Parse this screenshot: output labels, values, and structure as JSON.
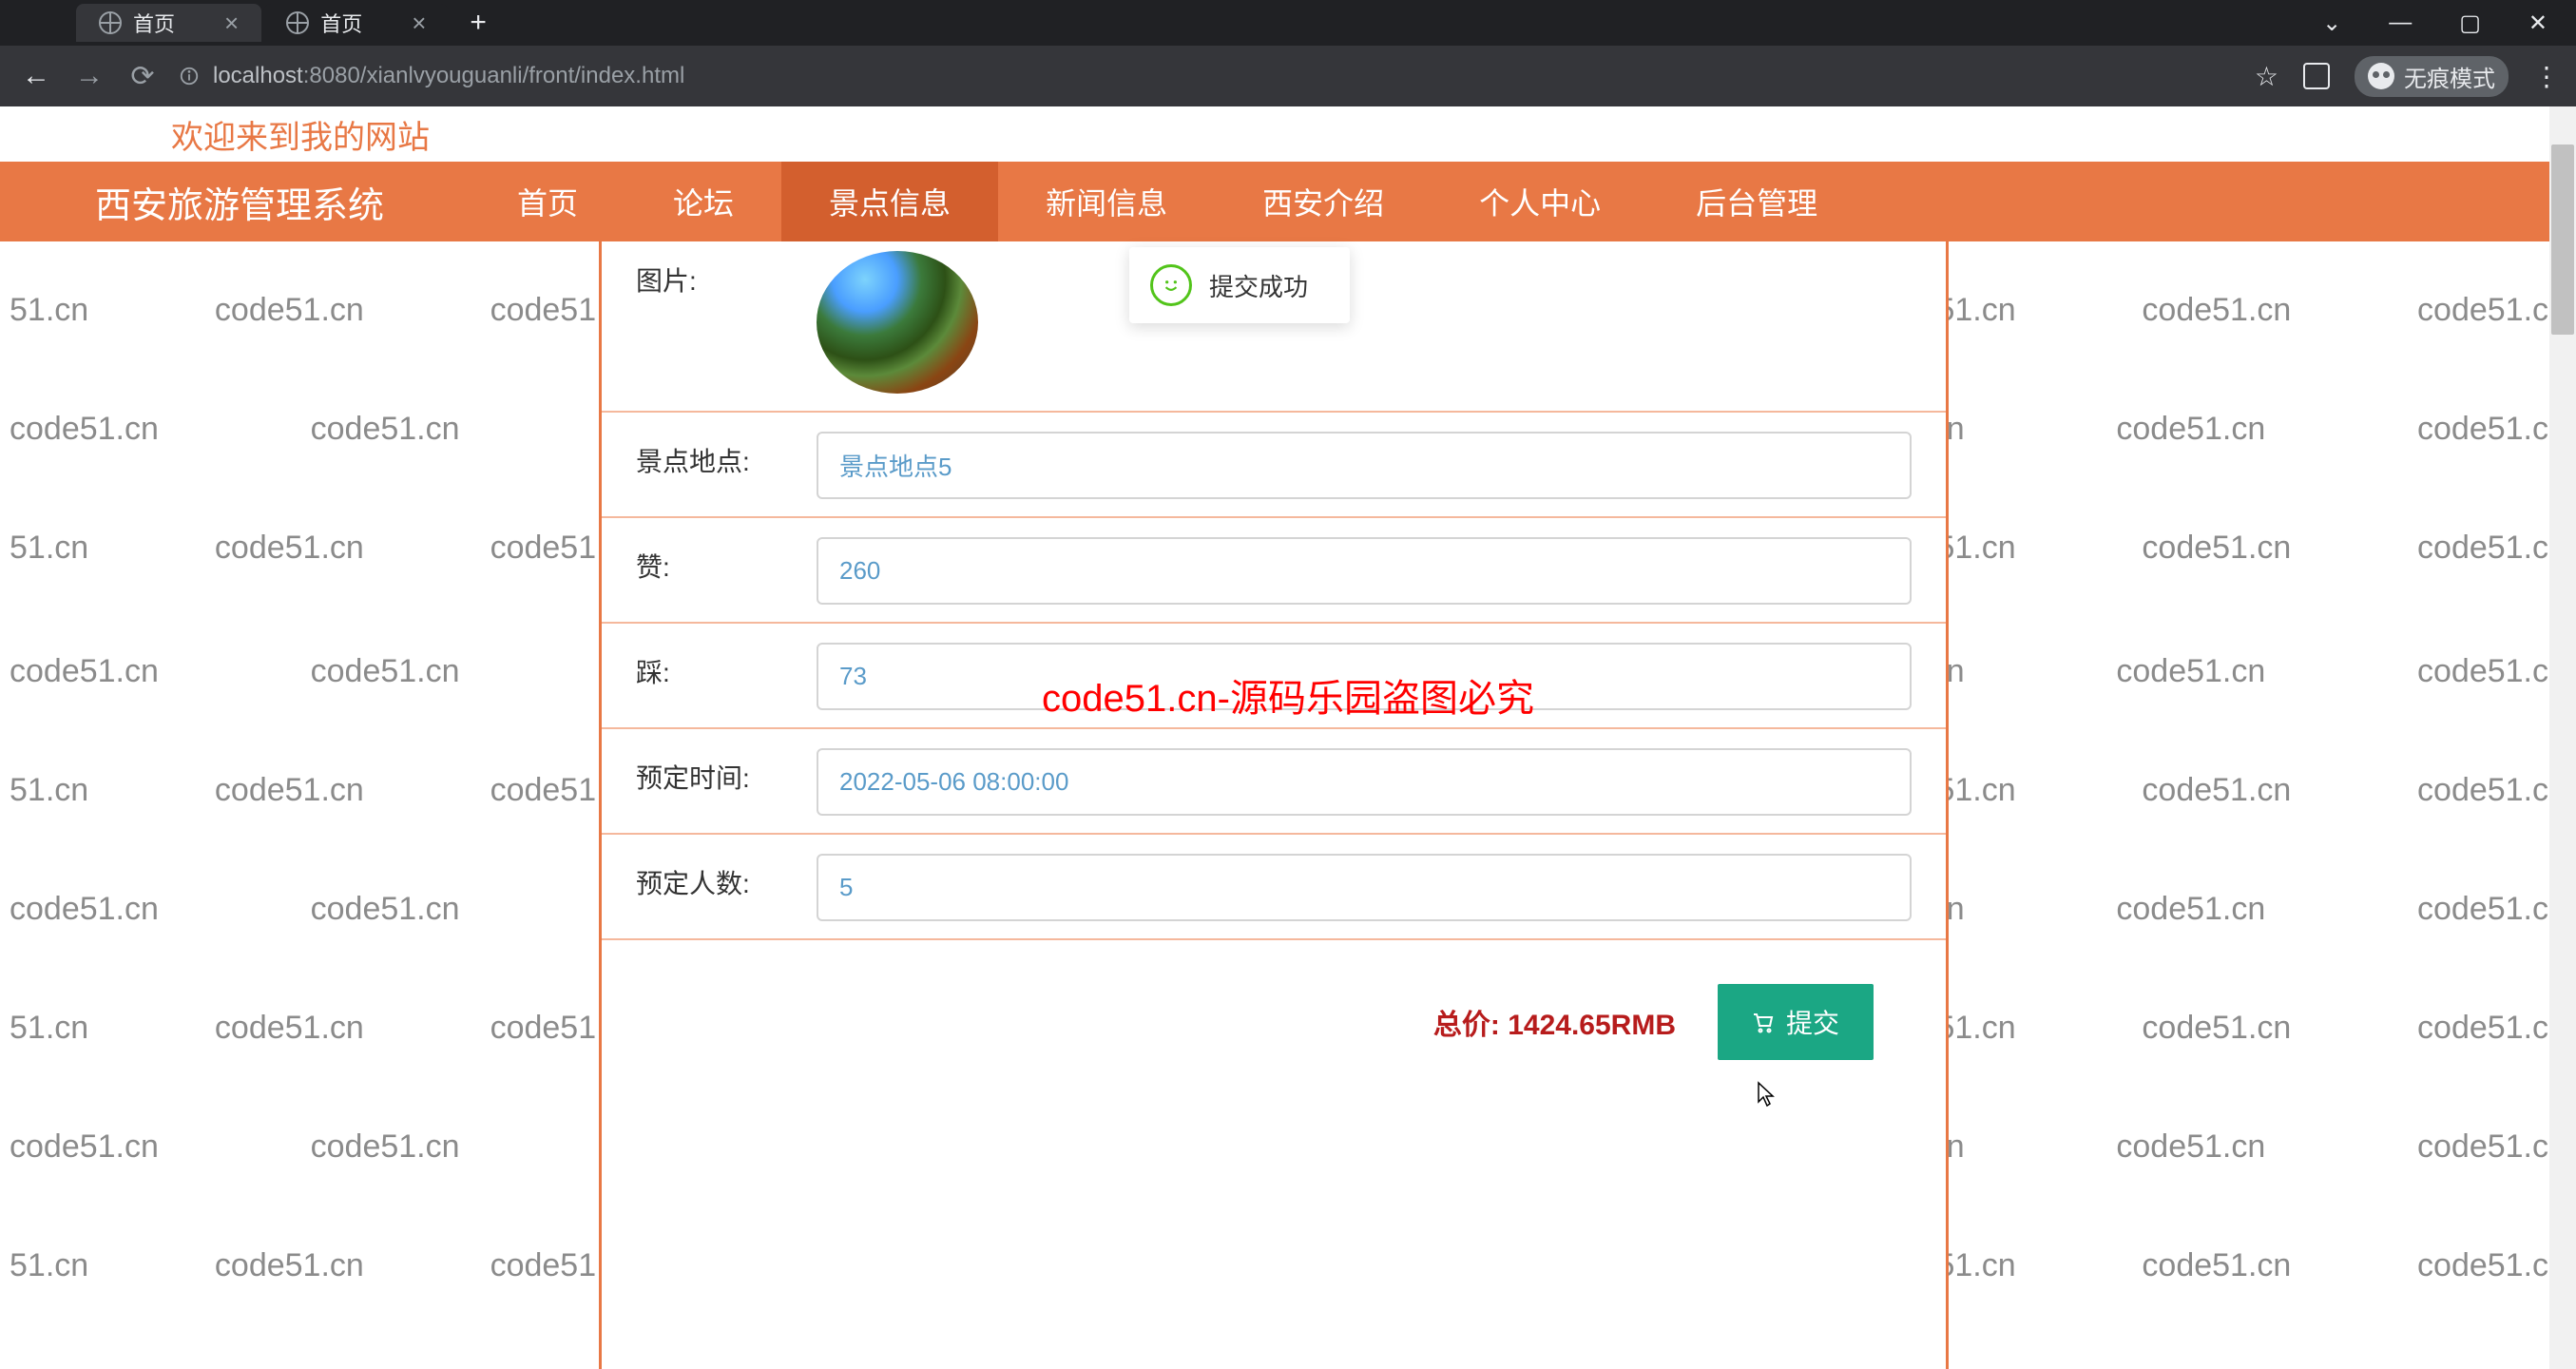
{
  "browser": {
    "tabs": [
      {
        "title": "首页"
      },
      {
        "title": "首页"
      }
    ],
    "url_host": "localhost",
    "url_port": ":8080",
    "url_path": "/xianlvyouguanli/front/index.html",
    "incognito_label": "无痕模式"
  },
  "page": {
    "welcome": "欢迎来到我的网站",
    "brand": "西安旅游管理系统",
    "nav": [
      "首页",
      "论坛",
      "景点信息",
      "新闻信息",
      "西安介绍",
      "个人中心",
      "后台管理"
    ],
    "active_nav_index": 2
  },
  "form": {
    "image_label": "图片:",
    "location_label": "景点地点:",
    "location_value": "景点地点5",
    "like_label": "赞:",
    "like_value": "260",
    "dislike_label": "踩:",
    "dislike_value": "73",
    "booking_time_label": "预定时间:",
    "booking_time_value": "2022-05-06 08:00:00",
    "booking_count_label": "预定人数:",
    "booking_count_value": "5",
    "total_label": "总价: ",
    "total_value": "1424.65RMB",
    "submit_label": "提交"
  },
  "toast": {
    "message": "提交成功"
  },
  "watermark": {
    "text": "code51.cn",
    "overlay": "code51.cn-源码乐园盗图必究"
  }
}
